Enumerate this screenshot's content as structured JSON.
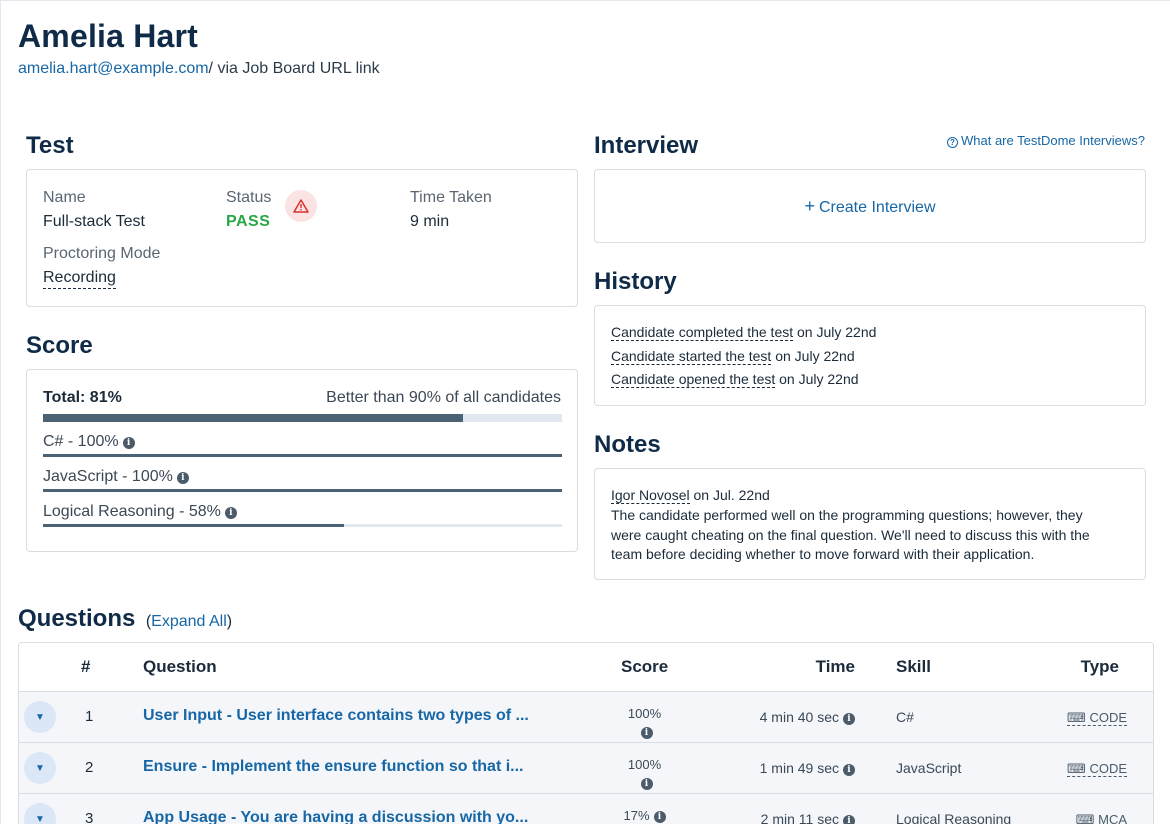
{
  "candidate": {
    "name": "Amelia Hart",
    "email": "amelia.hart@example.com",
    "source_prefix": "/ via ",
    "source": "Job Board URL link"
  },
  "test": {
    "heading": "Test",
    "name_label": "Name",
    "name_value": "Full-stack Test",
    "status_label": "Status",
    "status_value": "PASS",
    "time_label": "Time Taken",
    "time_value": "9 min",
    "proctoring_label": "Proctoring Mode",
    "proctoring_value": "Recording"
  },
  "score": {
    "heading": "Score",
    "total_label": "Total: 81%",
    "total_fraction": 0.81,
    "comparison": "Better than 90% of all candidates",
    "skills": [
      {
        "label": "C# - 100%",
        "fraction": 1.0
      },
      {
        "label": "JavaScript - 100%",
        "fraction": 1.0
      },
      {
        "label": "Logical Reasoning - 58%",
        "fraction": 0.58
      }
    ]
  },
  "interview": {
    "heading": "Interview",
    "help_link": "What are TestDome Interviews?",
    "create_label": "Create Interview"
  },
  "history": {
    "heading": "History",
    "events": [
      {
        "event": "Candidate completed the test",
        "date": " on July 22nd"
      },
      {
        "event": "Candidate started the test",
        "date": " on July 22nd"
      },
      {
        "event": "Candidate opened the test",
        "date": " on July 22nd"
      }
    ]
  },
  "notes": {
    "heading": "Notes",
    "author": "Igor Novosel",
    "date": " on Jul. 22nd",
    "line1": "The candidate performed well on the programming questions; however, they",
    "line2": "were caught cheating on the final question. We'll need to discuss this with the",
    "line3": "team before deciding whether to move forward with their application."
  },
  "questions": {
    "heading": "Questions",
    "expand_open": "(",
    "expand_label": "Expand All",
    "expand_close": ")",
    "columns": {
      "num": "#",
      "question": "Question",
      "score": "Score",
      "time": "Time",
      "skill": "Skill",
      "type": "Type"
    },
    "rows": [
      {
        "num": "1",
        "title": "User Input - User interface contains two types of ...",
        "score": "100%",
        "score_fraction": 1.0,
        "time": "4 min 40 sec",
        "skill": "C#",
        "type": "CODE"
      },
      {
        "num": "2",
        "title": "Ensure - Implement the ensure function so that i...",
        "score": "100%",
        "score_fraction": 1.0,
        "time": "1 min 49 sec",
        "skill": "JavaScript",
        "type": "CODE"
      },
      {
        "num": "3",
        "title": "App Usage - You are having a discussion with yo...",
        "score": "17%",
        "score_fraction": 0.17,
        "time": "2 min 11 sec",
        "skill": "Logical Reasoning",
        "type": "MCA"
      }
    ]
  },
  "colors": {
    "accent": "#1767a6",
    "pass": "#27a844",
    "bar": "#4b6275",
    "warning": "#d9302c"
  }
}
